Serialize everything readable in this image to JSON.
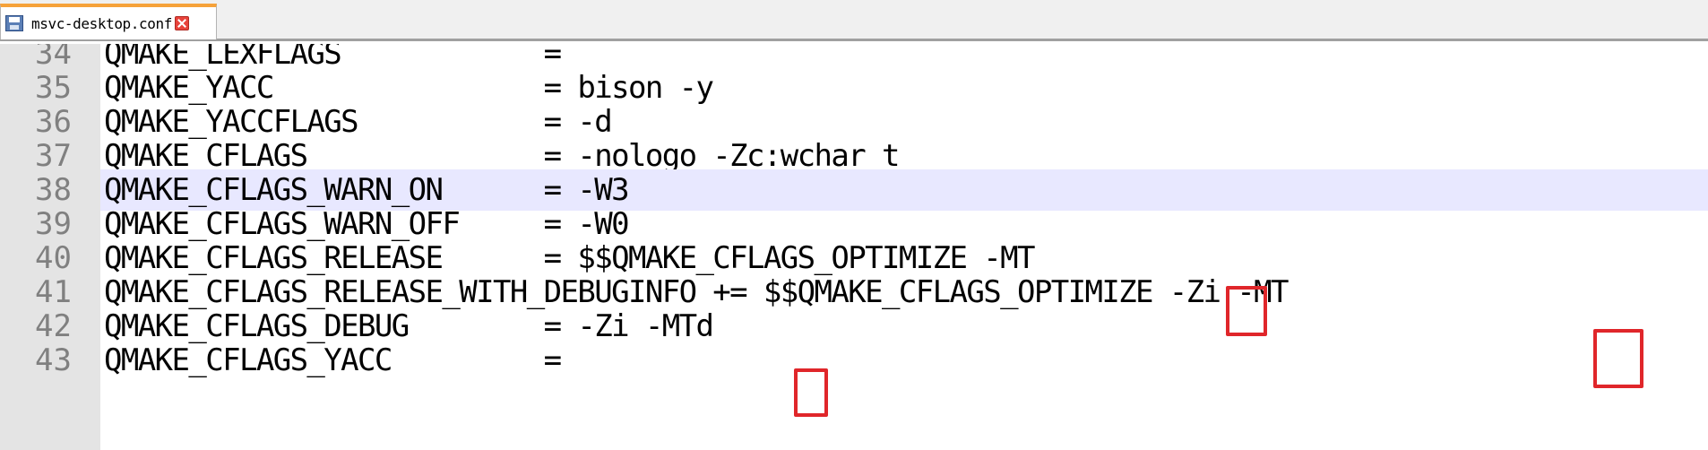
{
  "tab": {
    "title": "msvc-desktop.conf",
    "icon": "save-icon",
    "accent": "#f6a23a"
  },
  "editor": {
    "current_line": 38,
    "lines": [
      {
        "number": "34",
        "text": "QMAKE_LEXFLAGS            ="
      },
      {
        "number": "35",
        "text": "QMAKE_YACC                = bison -y"
      },
      {
        "number": "36",
        "text": "QMAKE_YACCFLAGS           = -d"
      },
      {
        "number": "37",
        "text": "QMAKE_CFLAGS              = -nologo -Zc:wchar_t"
      },
      {
        "number": "38",
        "text": "QMAKE_CFLAGS_WARN_ON      = -W3"
      },
      {
        "number": "39",
        "text": "QMAKE_CFLAGS_WARN_OFF     = -W0"
      },
      {
        "number": "40",
        "text": "QMAKE_CFLAGS_RELEASE      = $$QMAKE_CFLAGS_OPTIMIZE -MT"
      },
      {
        "number": "41",
        "text": "QMAKE_CFLAGS_RELEASE_WITH_DEBUGINFO += $$QMAKE_CFLAGS_OPTIMIZE -Zi -MT"
      },
      {
        "number": "42",
        "text": "QMAKE_CFLAGS_DEBUG        = -Zi -MTd"
      },
      {
        "number": "43",
        "text": "QMAKE_CFLAGS_YACC         ="
      }
    ]
  },
  "annotation_color": "#e0262a"
}
